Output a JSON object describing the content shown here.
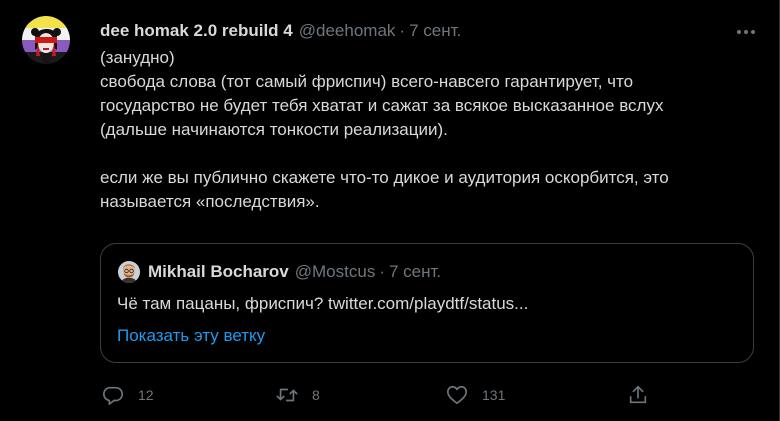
{
  "tweet": {
    "author_name": "dee homak 2.0 rebuild 4",
    "author_handle": "@deehomak",
    "separator": "·",
    "date": "7 сент.",
    "text_lines": [
      "(занудно)",
      "свобода слова (тот самый фриспич) всего-навсего гарантирует, что",
      "государство не будет тебя хватат и сажат за всякое высказанное вслух",
      "(дальше начинаются тонкости реализации).",
      "",
      "если же вы публично скажете что-то дикое и аудитория оскорбится, это",
      "называется «последствия»."
    ]
  },
  "quote": {
    "author_name": "Mikhail Bocharov",
    "author_handle": "@Mostcus",
    "separator": "·",
    "date": "7 сент.",
    "text": "Чё там пацаны, фриспич? twitter.com/playdtf/status...",
    "show_thread": "Показать эту ветку"
  },
  "actions": {
    "reply": {
      "icon": "reply-icon",
      "count": "12"
    },
    "retweet": {
      "icon": "retweet-icon",
      "count": "8"
    },
    "like": {
      "icon": "heart-icon",
      "count": "131"
    },
    "share": {
      "icon": "share-icon"
    }
  },
  "more": {
    "icon": "more-icon"
  },
  "colors": {
    "background": "#000000",
    "text": "#d9d9d9",
    "secondary": "#6e767d",
    "link": "#1d9bf0",
    "border": "#3a3d40"
  }
}
